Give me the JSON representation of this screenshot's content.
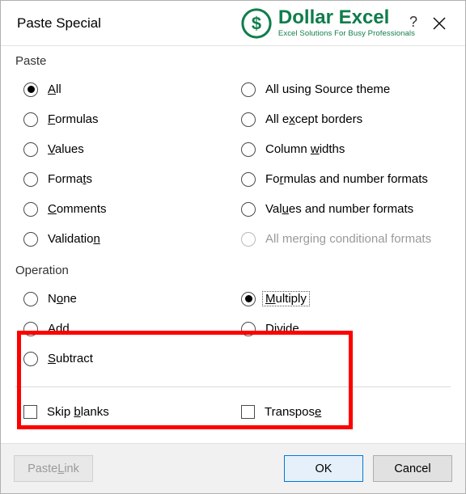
{
  "titlebar": {
    "title": "Paste Special",
    "brand_name": "Dollar Excel",
    "brand_tag": "Excel Solutions For Busy Professionals",
    "help": "?",
    "close_aria": "Close"
  },
  "paste": {
    "label": "Paste",
    "options": {
      "all": {
        "pre": "",
        "u": "A",
        "post": "ll",
        "checked": true
      },
      "formulas": {
        "pre": "",
        "u": "F",
        "post": "ormulas",
        "checked": false
      },
      "values": {
        "pre": "",
        "u": "V",
        "post": "alues",
        "checked": false
      },
      "formats": {
        "pre": "Forma",
        "u": "t",
        "post": "s",
        "checked": false
      },
      "comments": {
        "pre": "",
        "u": "C",
        "post": "omments",
        "checked": false
      },
      "validation": {
        "pre": "Validatio",
        "u": "n",
        "post": "",
        "checked": false
      },
      "source_theme": {
        "text": "All using Source theme",
        "checked": false
      },
      "except_borders": {
        "pre": "All e",
        "u": "x",
        "post": "cept borders",
        "checked": false
      },
      "col_widths": {
        "pre": "Column ",
        "u": "w",
        "post": "idths",
        "checked": false
      },
      "fmt_num": {
        "pre": "Fo",
        "u": "r",
        "post": "mulas and number formats",
        "checked": false
      },
      "val_num": {
        "pre": "Val",
        "u": "u",
        "post": "es and number formats",
        "checked": false
      },
      "merge_cond": {
        "text": "All merging conditional formats",
        "checked": false,
        "disabled": true
      }
    }
  },
  "operation": {
    "label": "Operation",
    "options": {
      "none": {
        "pre": "N",
        "u": "o",
        "post": "ne",
        "checked": false
      },
      "add": {
        "pre": "A",
        "u": "d",
        "post": "d",
        "checked": false
      },
      "subtract": {
        "pre": "",
        "u": "S",
        "post": "ubtract",
        "checked": false
      },
      "multiply": {
        "pre": "",
        "u": "M",
        "post": "ultiply",
        "checked": true,
        "focused": true
      },
      "divide": {
        "pre": "D",
        "u": "i",
        "post": "vide",
        "checked": false
      }
    }
  },
  "checks": {
    "skip_blanks": {
      "pre": "Skip ",
      "u": "b",
      "post": "lanks",
      "checked": false
    },
    "transpose": {
      "pre": "Transpos",
      "u": "e",
      "post": "",
      "checked": false
    }
  },
  "buttons": {
    "paste_link": {
      "pre": "Paste ",
      "u": "L",
      "post": "ink"
    },
    "ok": "OK",
    "cancel": "Cancel"
  }
}
